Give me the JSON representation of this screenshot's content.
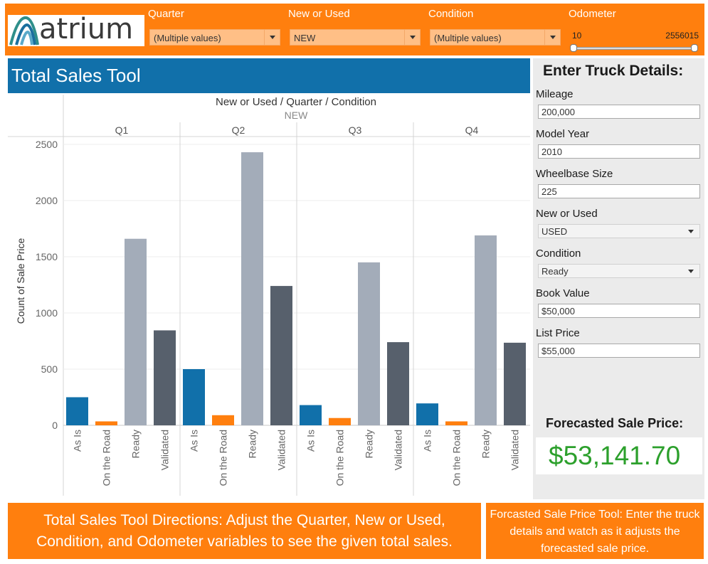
{
  "brand": {
    "name": "atrium"
  },
  "filters": {
    "quarter": {
      "label": "Quarter",
      "value": "(Multiple values)"
    },
    "new_or_used": {
      "label": "New or Used",
      "value": "NEW"
    },
    "condition": {
      "label": "Condition",
      "value": "(Multiple values)"
    },
    "odometer": {
      "label": "Odometer",
      "min": "10",
      "max": "2556015"
    }
  },
  "title": "Total Sales Tool",
  "chart_header": "New or Used  /  Quarter  /  Condition",
  "chart_data": {
    "type": "bar",
    "subheader": "NEW",
    "panels": [
      "Q1",
      "Q2",
      "Q3",
      "Q4"
    ],
    "categories": [
      "As Is",
      "On the Road",
      "Ready",
      "Validated"
    ],
    "series": [
      {
        "values": [
          250,
          35,
          1660,
          845
        ]
      },
      {
        "values": [
          500,
          90,
          2430,
          1240
        ]
      },
      {
        "values": [
          180,
          65,
          1450,
          740
        ]
      },
      {
        "values": [
          195,
          35,
          1690,
          735
        ]
      }
    ],
    "colors": [
      "#1170aa",
      "#ff7f0e",
      "#a3acb9",
      "#57606c"
    ],
    "ylabel": "Count of Sale Price",
    "yticks": [
      0,
      500,
      1000,
      1500,
      2000,
      2500
    ],
    "ylim": [
      0,
      2500
    ],
    "grid": true
  },
  "panel": {
    "title": "Enter Truck Details:",
    "mileage": {
      "label": "Mileage",
      "value": "200,000"
    },
    "model_year": {
      "label": "Model Year",
      "value": "2010"
    },
    "wheelbase": {
      "label": "Wheelbase Size",
      "value": "225"
    },
    "new_or_used": {
      "label": "New or Used",
      "value": "USED"
    },
    "condition": {
      "label": "Condition",
      "value": "Ready"
    },
    "book_value": {
      "label": "Book Value",
      "value": "$50,000"
    },
    "list_price": {
      "label": "List Price",
      "value": "$55,000"
    },
    "forecast_label": "Forecasted Sale Price:",
    "forecast_value": "$53,141.70"
  },
  "directions": {
    "left": "Total Sales Tool Directions: Adjust the Quarter, New or Used, Condition, and Odometer variables to see the given total sales.",
    "right": "Forcasted Sale Price Tool: Enter the truck details and watch as it adjusts the forecasted sale price."
  }
}
